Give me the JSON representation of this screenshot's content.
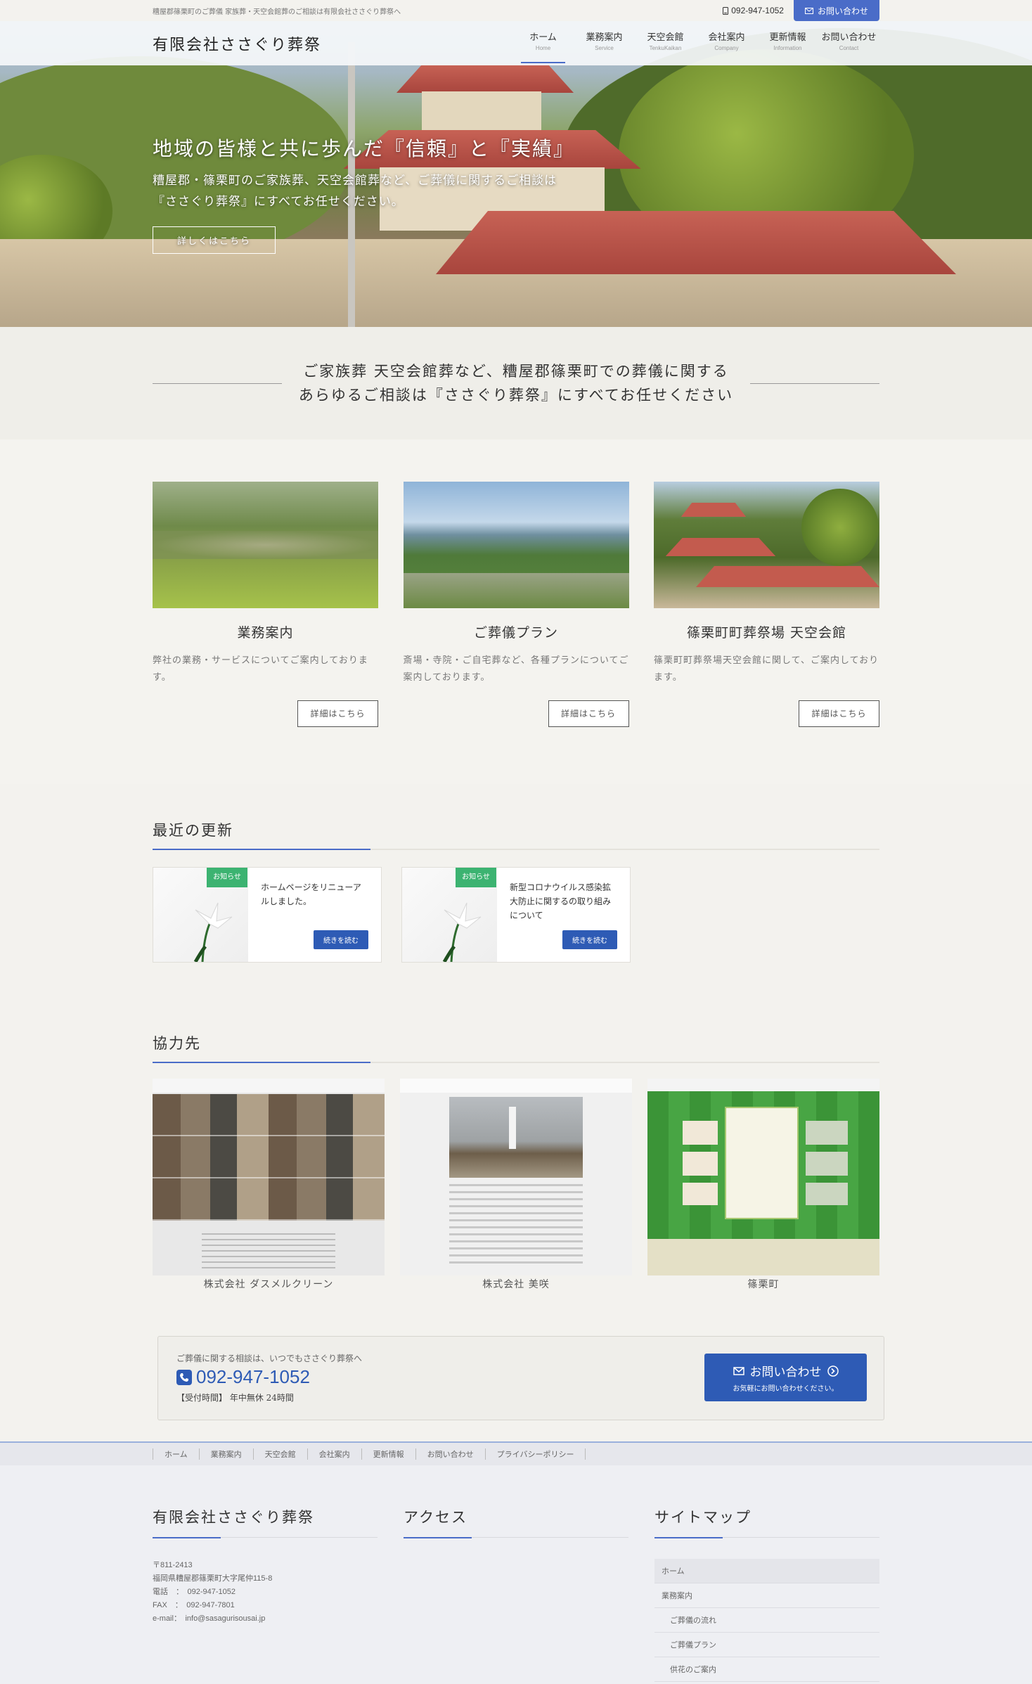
{
  "topbar": {
    "tagline": "糟屋郡篠栗町のご葬儀 家族葬・天空会館葬のご相談は有限会社ささぐり葬祭へ",
    "phone": "092-947-1052",
    "contact_button": "お問い合わせ"
  },
  "header": {
    "logo": "有限会社ささぐり葬祭",
    "nav": [
      {
        "jp": "ホーム",
        "en": "Home"
      },
      {
        "jp": "業務案内",
        "en": "Service"
      },
      {
        "jp": "天空会館",
        "en": "TenkuKaikan"
      },
      {
        "jp": "会社案内",
        "en": "Company"
      },
      {
        "jp": "更新情報",
        "en": "Information"
      },
      {
        "jp": "お問い合わせ",
        "en": "Contact"
      }
    ]
  },
  "hero": {
    "title": "地域の皆様と共に歩んだ『信頼』と『実績』",
    "sub_line1": "糟屋郡・篠栗町のご家族葬、天空会館葬など、ご葬儀に関するご相談は",
    "sub_line2": "『ささぐり葬祭』にすべてお任せください。",
    "button": "詳しくはこちら"
  },
  "intro": {
    "line1": "ご家族葬 天空会館葬など、糟屋郡篠栗町での葬儀に関する",
    "line2": "あらゆるご相談は『ささぐり葬祭』にすべてお任せください"
  },
  "services": [
    {
      "title": "業務案内",
      "desc": "弊社の業務・サービスについてご案内しております。",
      "button": "詳細はこちら"
    },
    {
      "title": "ご葬儀プラン",
      "desc": "斎場・寺院・ご自宅葬など、各種プランについてご案内しております。",
      "button": "詳細はこちら"
    },
    {
      "title": "篠栗町町葬祭場 天空会館",
      "desc": "篠栗町町葬祭場天空会館に関して、ご案内しております。",
      "button": "詳細はこちら"
    }
  ],
  "news": {
    "title": "最近の更新",
    "items": [
      {
        "badge": "お知らせ",
        "title": "ホームページをリニューアルしました。",
        "button": "続きを読む"
      },
      {
        "badge": "お知らせ",
        "title": "新型コロナウイルス感染拡大防止に関するの取り組みについて",
        "button": "続きを読む"
      }
    ]
  },
  "partners": {
    "title": "協力先",
    "items": [
      {
        "name": "株式会社 ダスメルクリーン"
      },
      {
        "name": "株式会社 美咲"
      },
      {
        "name": "篠栗町"
      }
    ]
  },
  "contact": {
    "lead": "ご葬儀に関する相談は、いつでもささぐり葬祭へ",
    "phone": "092-947-1052",
    "hours": "【受付時間】 年中無休 24時間",
    "button_main": "お問い合わせ",
    "button_sub": "お気軽にお問い合わせください。"
  },
  "footer": {
    "nav": [
      "ホーム",
      "業務案内",
      "天空会館",
      "会社案内",
      "更新情報",
      "お問い合わせ",
      "プライバシーポリシー"
    ],
    "company": {
      "title": "有限会社ささぐり葬祭",
      "postal": "〒811-2413",
      "address": "福岡県糟屋郡篠栗町大字尾仲115-8",
      "tel": "電話　：　092-947-1052",
      "fax": "FAX　：　092-947-7801",
      "email": "e-mail：　info@sasagurisousai.jp"
    },
    "access": {
      "title": "アクセス"
    },
    "sitemap": {
      "title": "サイトマップ",
      "items": [
        {
          "label": "ホーム",
          "indent": false
        },
        {
          "label": "業務案内",
          "indent": false
        },
        {
          "label": "ご葬儀の流れ",
          "indent": true
        },
        {
          "label": "ご葬儀プラン",
          "indent": true
        },
        {
          "label": "供花のご案内",
          "indent": true
        }
      ]
    }
  }
}
